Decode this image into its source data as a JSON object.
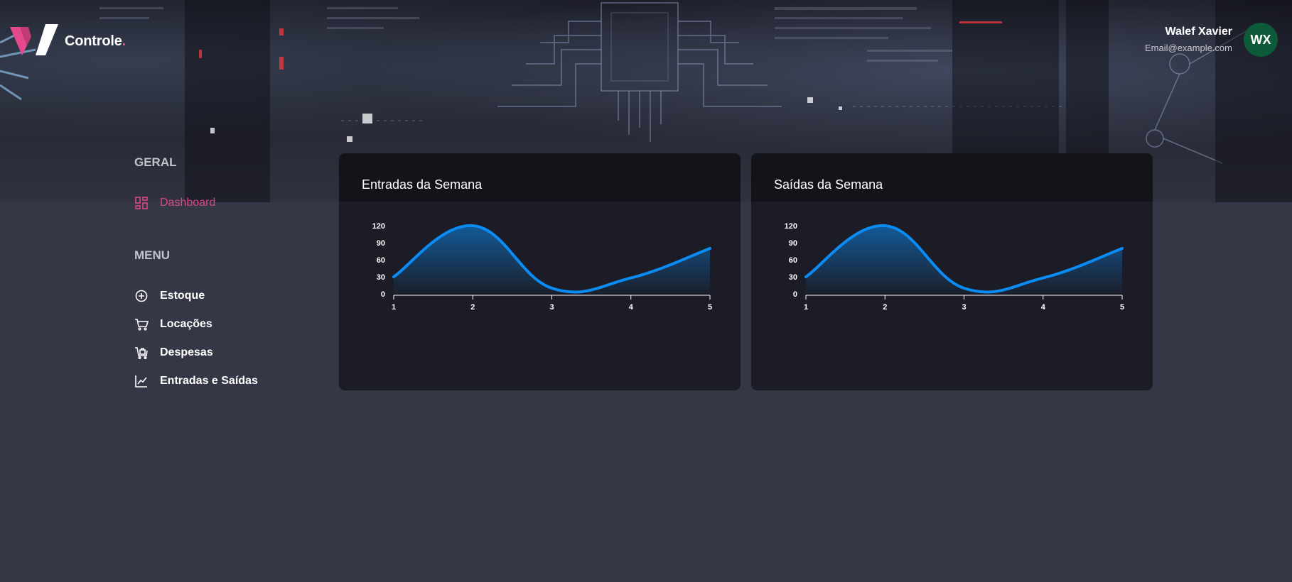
{
  "header": {
    "brand": "Controle",
    "brand_dot": ".",
    "user": {
      "name": "Walef Xavier",
      "email": "Email@example.com",
      "initials": "WX"
    }
  },
  "sidebar": {
    "general_title": "GERAL",
    "general_items": [
      {
        "label": "Dashboard",
        "icon": "dashboard-icon",
        "active": true
      }
    ],
    "menu_title": "MENU",
    "menu_items": [
      {
        "label": "Estoque",
        "icon": "plus-circle-icon"
      },
      {
        "label": "Locações",
        "icon": "cart-icon"
      },
      {
        "label": "Despesas",
        "icon": "shopping-bag-icon"
      },
      {
        "label": "Entradas e Saídas",
        "icon": "line-chart-icon"
      }
    ]
  },
  "colors": {
    "accent": "#d9478a",
    "chart_line": "#0b8cf5",
    "avatar": "#0c5a3a",
    "background": "#363746",
    "card": "#1b1c25"
  },
  "chart_data": [
    {
      "type": "area",
      "title": "Entradas da Semana",
      "x": [
        1,
        2,
        3,
        4,
        5
      ],
      "values": [
        30,
        120,
        10,
        28,
        80
      ],
      "ylim": [
        0,
        120
      ],
      "yticks": [
        0,
        30,
        60,
        90,
        120
      ],
      "grid": false
    },
    {
      "type": "area",
      "title": "Saídas da Semana",
      "x": [
        1,
        2,
        3,
        4,
        5
      ],
      "values": [
        30,
        120,
        10,
        28,
        80
      ],
      "ylim": [
        0,
        120
      ],
      "yticks": [
        0,
        30,
        60,
        90,
        120
      ],
      "grid": false
    }
  ]
}
